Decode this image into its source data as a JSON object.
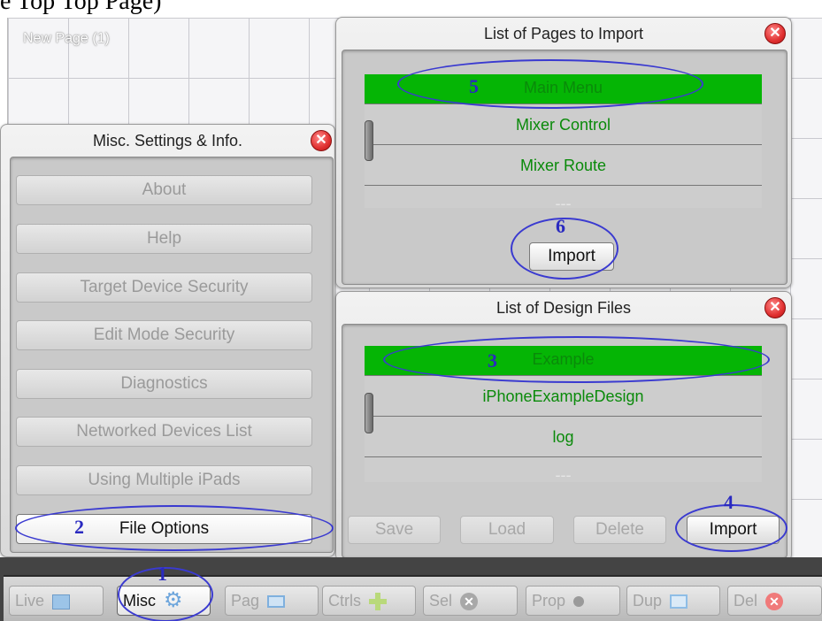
{
  "crop_text": "e Top Top Page)",
  "canvas": {
    "page_name": "New Page (1)"
  },
  "misc_panel": {
    "title": "Misc. Settings & Info.",
    "items": [
      {
        "label": "About"
      },
      {
        "label": "Help"
      },
      {
        "label": "Target Device Security"
      },
      {
        "label": "Edit Mode Security"
      },
      {
        "label": "Diagnostics"
      },
      {
        "label": "Networked Devices List"
      },
      {
        "label": "Using Multiple iPads"
      },
      {
        "label": "File Options"
      }
    ]
  },
  "pages_panel": {
    "title": "List of Pages to Import",
    "rows": [
      "Main Menu",
      "Mixer Control",
      "Mixer Route",
      "---"
    ],
    "import_label": "Import"
  },
  "design_panel": {
    "title": "List of Design Files",
    "rows": [
      "Example",
      "iPhoneExampleDesign",
      "log",
      "---"
    ],
    "buttons": {
      "save": "Save",
      "load": "Load",
      "delete": "Delete",
      "import": "Import"
    }
  },
  "toolbar": {
    "buttons": [
      {
        "label": "Live"
      },
      {
        "label": "Misc"
      },
      {
        "label": "Pag"
      },
      {
        "label": "Ctrls"
      },
      {
        "label": "Sel"
      },
      {
        "label": "Prop"
      },
      {
        "label": "Dup"
      },
      {
        "label": "Del"
      }
    ]
  },
  "annotations": [
    "1",
    "2",
    "3",
    "4",
    "5",
    "6"
  ],
  "colors": {
    "selected_row": "#05b505",
    "list_text": "#0a8a0a",
    "annotation": "#2a2ac0",
    "close": "#e03030"
  }
}
